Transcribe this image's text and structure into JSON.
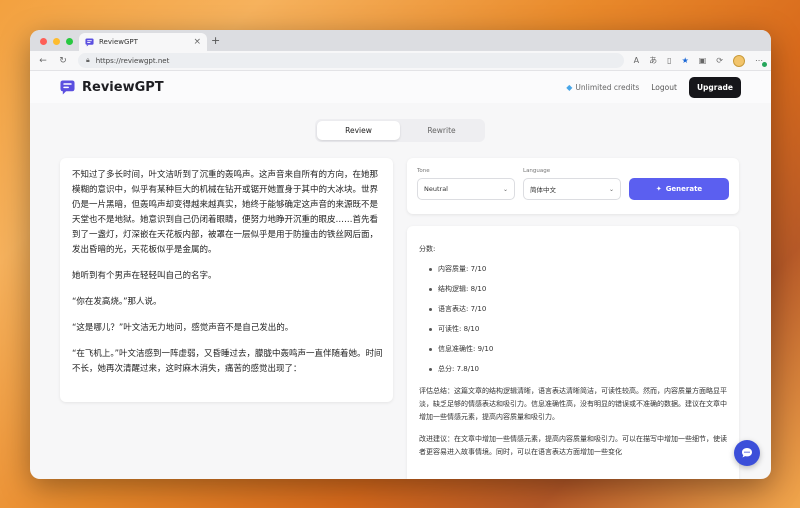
{
  "browser": {
    "tab_title": "ReviewGPT",
    "url": "https://reviewgpt.net",
    "new_tab_symbol": "+",
    "close_symbol": "×"
  },
  "header": {
    "brand": "ReviewGPT",
    "credits": "Unlimited credits",
    "logout": "Logout",
    "upgrade": "Upgrade"
  },
  "mode_toggle": {
    "review": "Review",
    "rewrite": "Rewrite",
    "active": "review"
  },
  "input_text": [
    "不知过了多长时间，叶文洁听到了沉重的轰鸣声。这声音来自所有的方向，在她那模糊的意识中，似乎有某种巨大的机械在钻开或锯开她置身于其中的大冰块。世界仍是一片黑暗，但轰鸣声却变得越来越真实，她终于能够确定这声音的来源既不是天堂也不是地狱。她意识到自己仍闭着眼睛，便努力地睁开沉重的眼皮……首先看到了一盏灯，灯深嵌在天花板内部，被罩在一层似乎是用于防撞击的铁丝网后面，发出昏暗的光，天花板似乎是金属的。",
    "她听到有个男声在轻轻叫自己的名字。",
    "“你在发高烧。”那人说。",
    "“这是哪儿？”叶文洁无力地问，感觉声音不是自己发出的。",
    "“在飞机上。”叶文洁感到一阵虚弱，又昏睡过去，朦胧中轰鸣声一直伴随着她。时间不长，她再次清醒过来，这时麻木消失，痛苦的感觉出现了："
  ],
  "controls": {
    "tone_label": "Tone",
    "tone_value": "Neutral",
    "language_label": "Language",
    "language_value": "简体中文",
    "generate": "Generate"
  },
  "result": {
    "score_title": "分数:",
    "scores": [
      "内容质量: 7/10",
      "结构逻辑: 8/10",
      "语言表达: 7/10",
      "可读性: 8/10",
      "信息准确性: 9/10",
      "总分: 7.8/10"
    ],
    "summary": "评估总结：这篇文章的结构逻辑清晰，语言表达清晰简洁，可读性较高。然而，内容质量方面略显平淡，缺乏足够的情感表达和吸引力。信息准确性高，没有明显的错误或不准确的数据。建议在文章中增加一些情感元素，提高内容质量和吸引力。",
    "suggestion": "改进建议：在文章中增加一些情感元素，提高内容质量和吸引力。可以在描写中增加一些细节，使读者更容易进入故事情境。同时，可以在语言表达方面增加一些变化"
  },
  "colors": {
    "accent": "#5b5ff0",
    "brand": "#5b4fe0",
    "fab": "#3c4fd9"
  }
}
